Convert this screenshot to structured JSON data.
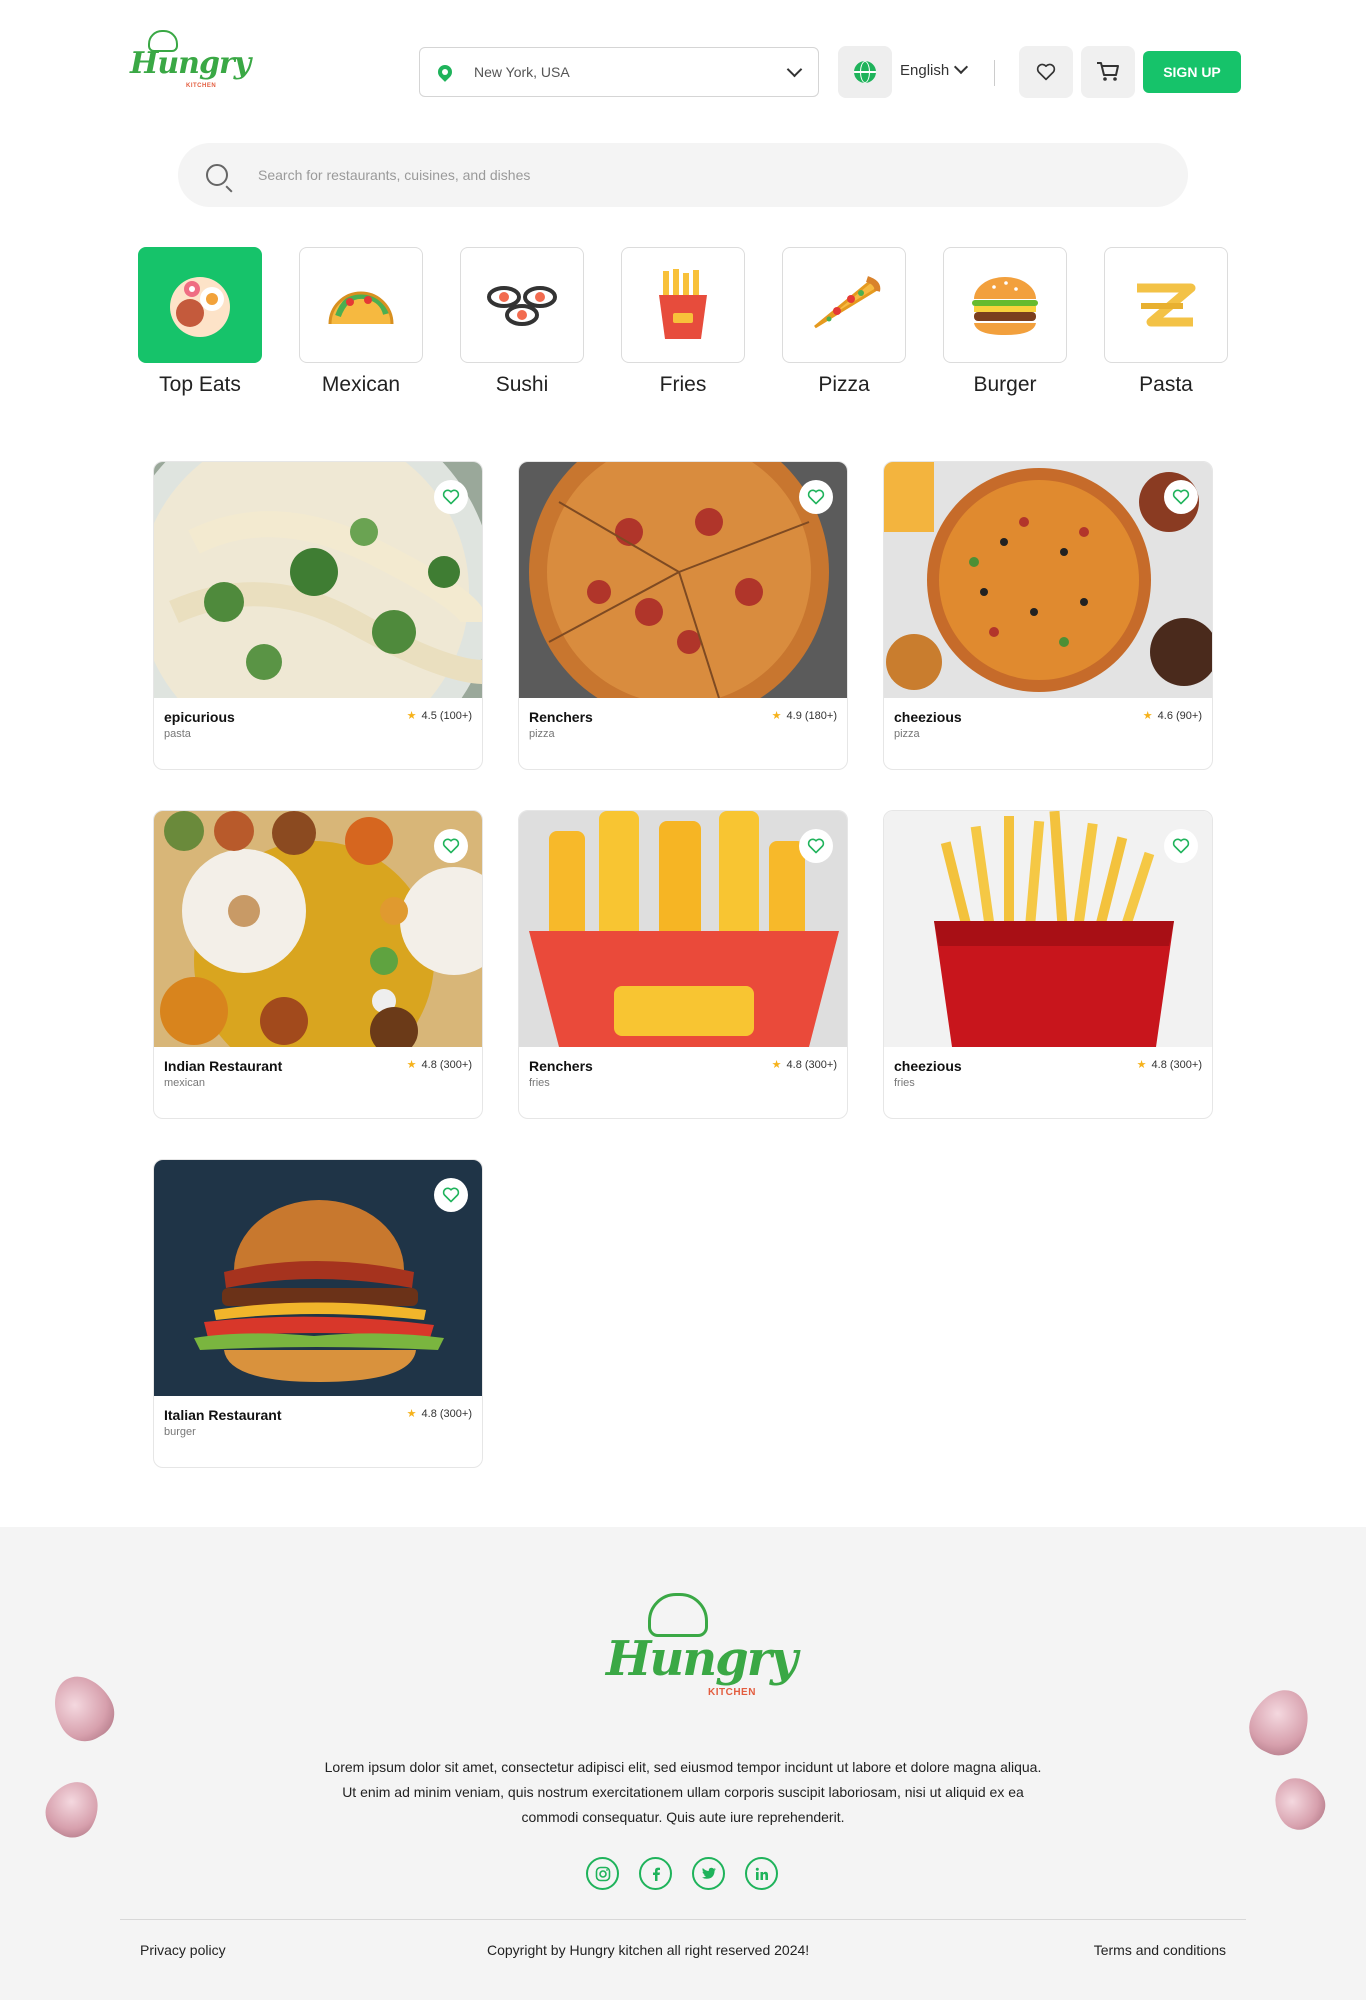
{
  "header": {
    "logo_text": "Hungry",
    "logo_sub": "KITCHEN",
    "location": "New York, USA",
    "language": "English",
    "signup_label": "SIGN UP"
  },
  "search": {
    "placeholder": "Search for restaurants, cuisines, and dishes"
  },
  "categories": [
    {
      "label": "Top Eats",
      "active": true
    },
    {
      "label": "Mexican",
      "active": false
    },
    {
      "label": "Sushi",
      "active": false
    },
    {
      "label": "Fries",
      "active": false
    },
    {
      "label": "Pizza",
      "active": false
    },
    {
      "label": "Burger",
      "active": false
    },
    {
      "label": "Pasta",
      "active": false
    }
  ],
  "restaurants": [
    {
      "name": "epicurious",
      "category": "pasta",
      "rating": "4.5",
      "reviews": "(100+)"
    },
    {
      "name": "Renchers",
      "category": "pizza",
      "rating": "4.9",
      "reviews": "(180+)"
    },
    {
      "name": "cheezious",
      "category": "pizza",
      "rating": "4.6",
      "reviews": "(90+)"
    },
    {
      "name": "Indian Restaurant",
      "category": "mexican",
      "rating": "4.8",
      "reviews": "(300+)"
    },
    {
      "name": "Renchers",
      "category": "fries",
      "rating": "4.8",
      "reviews": "(300+)"
    },
    {
      "name": "cheezious",
      "category": "fries",
      "rating": "4.8",
      "reviews": "(300+)"
    },
    {
      "name": "Italian Restaurant",
      "category": "burger",
      "rating": "4.8",
      "reviews": "(300+)"
    }
  ],
  "footer": {
    "logo_text": "Hungry",
    "logo_sub": "KITCHEN",
    "description": "Lorem ipsum dolor sit amet, consectetur adipisci elit, sed eiusmod tempor incidunt ut labore et dolore magna aliqua. Ut enim ad minim veniam, quis nostrum exercitationem ullam corporis suscipit laboriosam, nisi ut aliquid ex ea commodi consequatur. Quis aute iure reprehenderit.",
    "privacy": "Privacy policy",
    "copyright": "Copyright by Hungry kitchen all right reserved 2024!",
    "terms": "Terms and conditions",
    "socials": [
      "instagram-icon",
      "facebook-icon",
      "twitter-icon",
      "linkedin-icon"
    ]
  },
  "colors": {
    "accent": "#16c36a",
    "brand_green": "#3aa845",
    "star": "#f6b21b"
  }
}
